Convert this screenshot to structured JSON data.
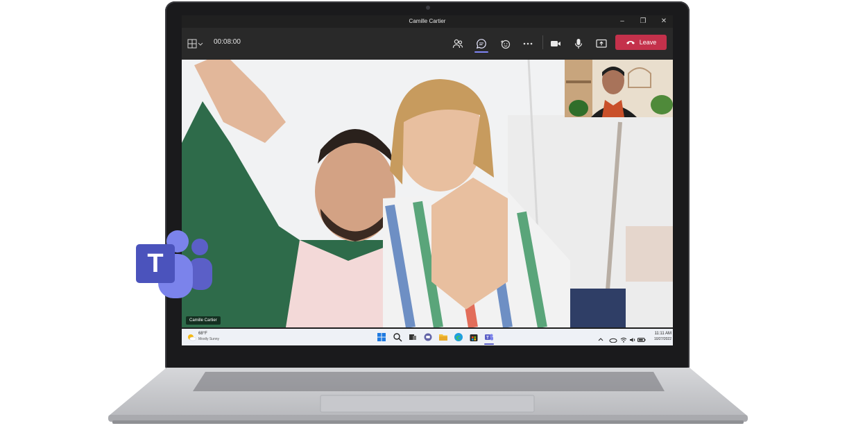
{
  "window": {
    "title": "Camille Cartier",
    "controls": {
      "minimize": "–",
      "maximize": "❐",
      "close": "✕"
    }
  },
  "toolbar": {
    "timer": "00:08:00",
    "leave_label": "Leave"
  },
  "video": {
    "main_speaker_name": "Camille Cartier"
  },
  "taskbar": {
    "weather_temp": "68°F",
    "weather_desc": "Mostly Sunny",
    "time": "11:11 AM",
    "date": "10/27/2022"
  },
  "colors": {
    "leave": "#c4314b",
    "teams_brand": "#5b5fc7",
    "accent": "#7f85f5"
  },
  "icons": [
    "layout-icon",
    "chevron-down-icon",
    "people-icon",
    "chat-icon",
    "reactions-icon",
    "more-icon",
    "camera-icon",
    "mic-icon",
    "share-icon",
    "hangup-icon",
    "teams-logo"
  ]
}
